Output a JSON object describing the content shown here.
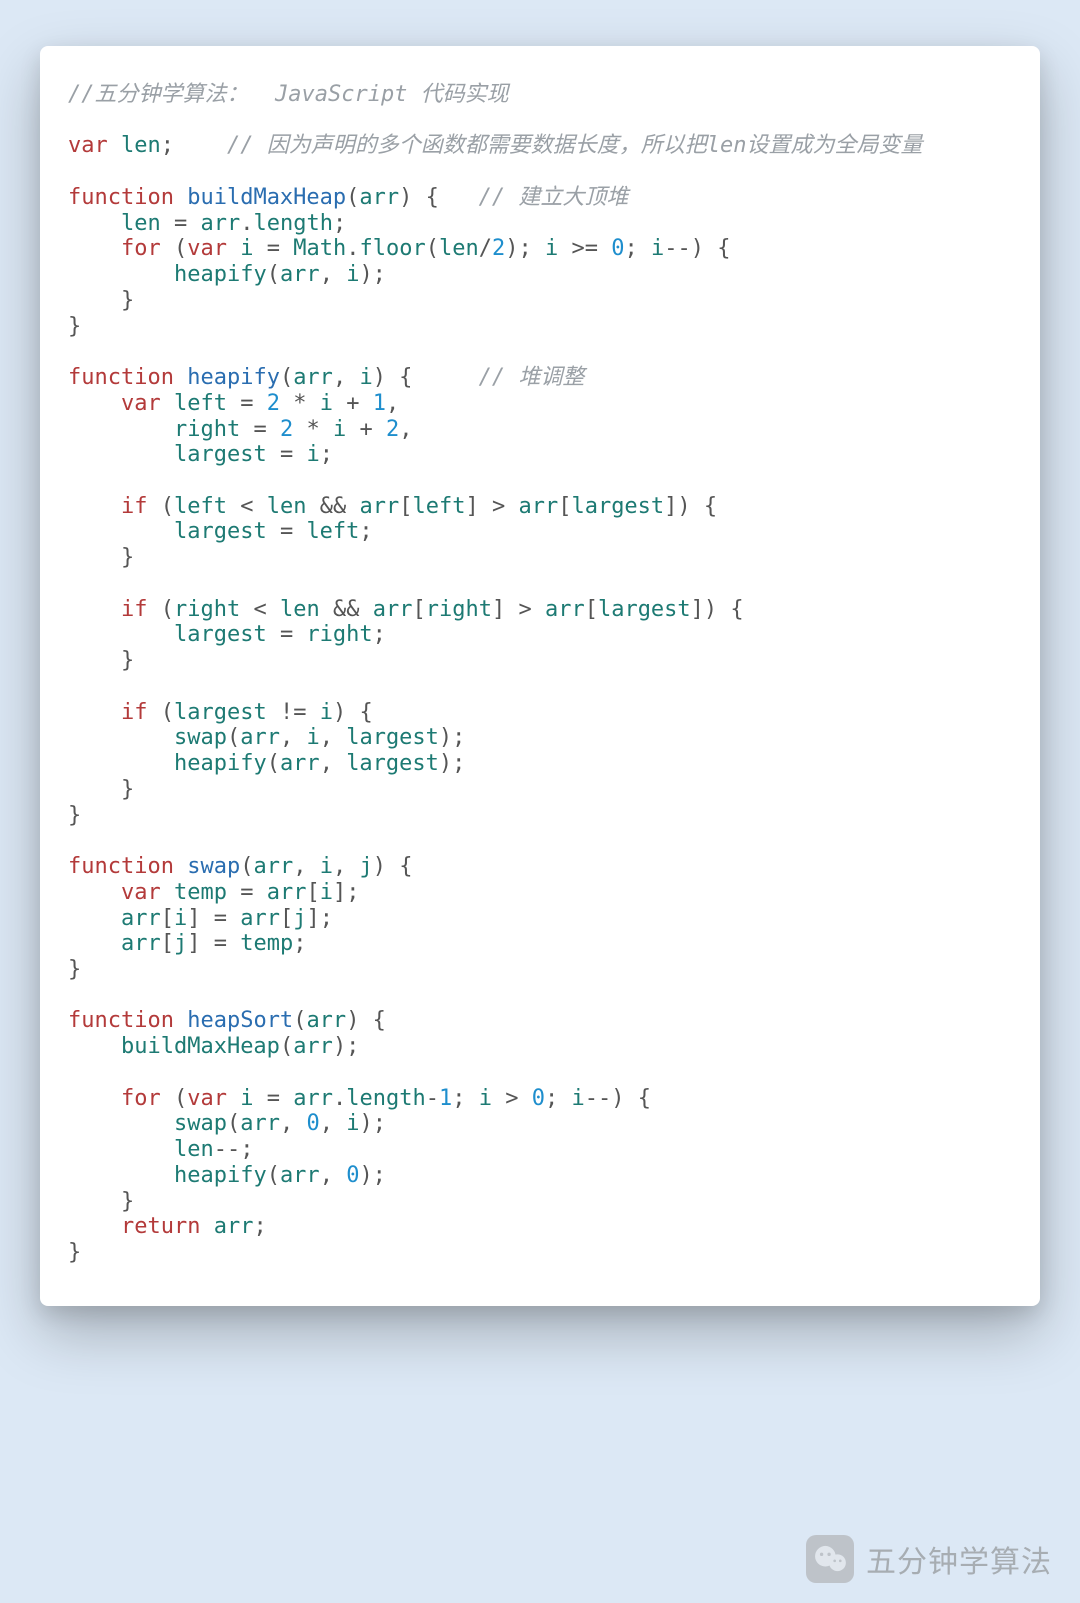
{
  "watermark": {
    "text": "五分钟学算法"
  },
  "code": {
    "title_comment": "//五分钟学算法：  JavaScript 代码实现",
    "len_comment": "// 因为声明的多个函数都需要数据长度，所以把len设置成为全局变量",
    "buildMaxHeap_comment": "// 建立大顶堆",
    "heapify_comment": "// 堆调整",
    "kw_var": "var",
    "kw_function": "function",
    "kw_for": "for",
    "kw_if": "if",
    "kw_return": "return",
    "id_len": "len",
    "id_arr": "arr",
    "id_i": "i",
    "id_j": "j",
    "id_left": "left",
    "id_right": "right",
    "id_largest": "largest",
    "id_temp": "temp",
    "id_length": "length",
    "id_Math": "Math",
    "id_floor": "floor",
    "fn_buildMaxHeap": "buildMaxHeap",
    "fn_heapify": "heapify",
    "fn_swap": "swap",
    "fn_heapSort": "heapSort",
    "n0": "0",
    "n1": "1",
    "n2": "2"
  }
}
